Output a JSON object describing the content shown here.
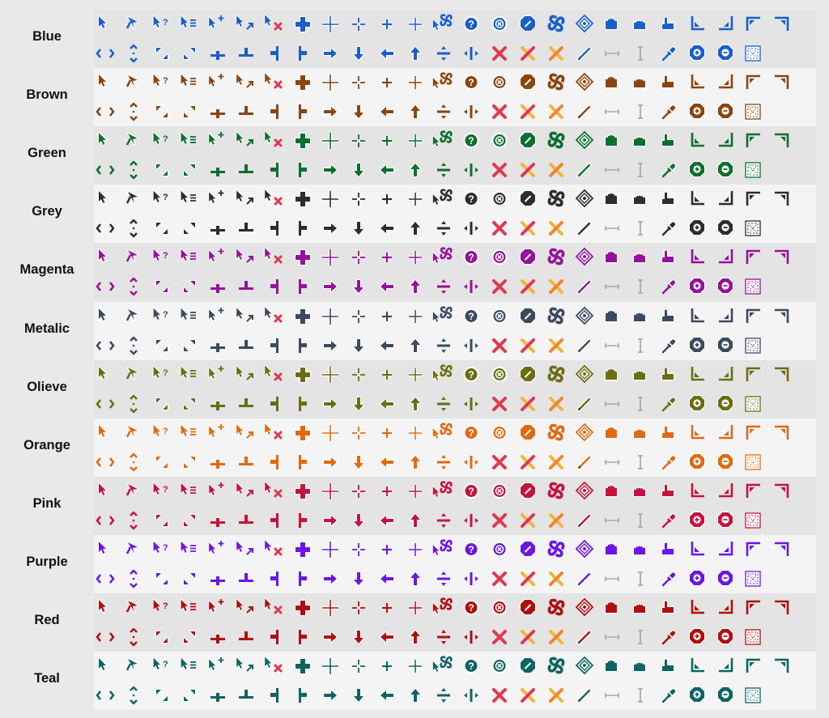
{
  "title": "",
  "themes": [
    {
      "name": "Blue",
      "color": "#1a5fc8"
    },
    {
      "name": "Brown",
      "color": "#8a4510"
    },
    {
      "name": "Green",
      "color": "#0c6f2e"
    },
    {
      "name": "Grey",
      "color": "#2d2d2d"
    },
    {
      "name": "Magenta",
      "color": "#95129a"
    },
    {
      "name": "Metalic",
      "color": "#3b4a5f"
    },
    {
      "name": "Olieve",
      "color": "#6b6d12"
    },
    {
      "name": "Orange",
      "color": "#e06a12"
    },
    {
      "name": "Pink",
      "color": "#c4133e"
    },
    {
      "name": "Purple",
      "color": "#6a16e6"
    },
    {
      "name": "Red",
      "color": "#b00f10"
    },
    {
      "name": "Teal",
      "color": "#0f6463"
    }
  ],
  "static_colors": {
    "x_red": "#e0384f",
    "x_yellow": "#f2b43a",
    "pale": "#a9a9a9",
    "band_light": "#f4f4f4"
  },
  "row1_icons": [
    "arrow-pointer",
    "alternate-pointer",
    "help-pointer",
    "list-pointer",
    "add-pointer",
    "link-pointer",
    "no-drop-pointer",
    "plus-cross",
    "precision-cross",
    "dotted-cross",
    "small-cross",
    "thin-cross",
    "busy-pointer",
    "help-badge",
    "close-badge",
    "not-allowed-badge",
    "spinner",
    "move-diamond",
    "hand-open",
    "hand-grab",
    "hand-point",
    "corner-bottom-left",
    "corner-bottom-right",
    "corner-top-left",
    "corner-top-right"
  ],
  "row2_icons": [
    "resize-horizontal",
    "resize-vertical",
    "resize-diagonal-nwse",
    "resize-diagonal-nesw",
    "align-bottom",
    "align-top",
    "align-right",
    "align-left",
    "arrow-right",
    "arrow-down",
    "arrow-left",
    "arrow-up",
    "split-vertical",
    "split-horizontal",
    "x-cross",
    "x-yellow-red",
    "x-yellow",
    "pencil",
    "size-horizontal-pale",
    "text-cursor-pale",
    "pipette",
    "zoom-in",
    "zoom-out",
    "dotted-box"
  ]
}
